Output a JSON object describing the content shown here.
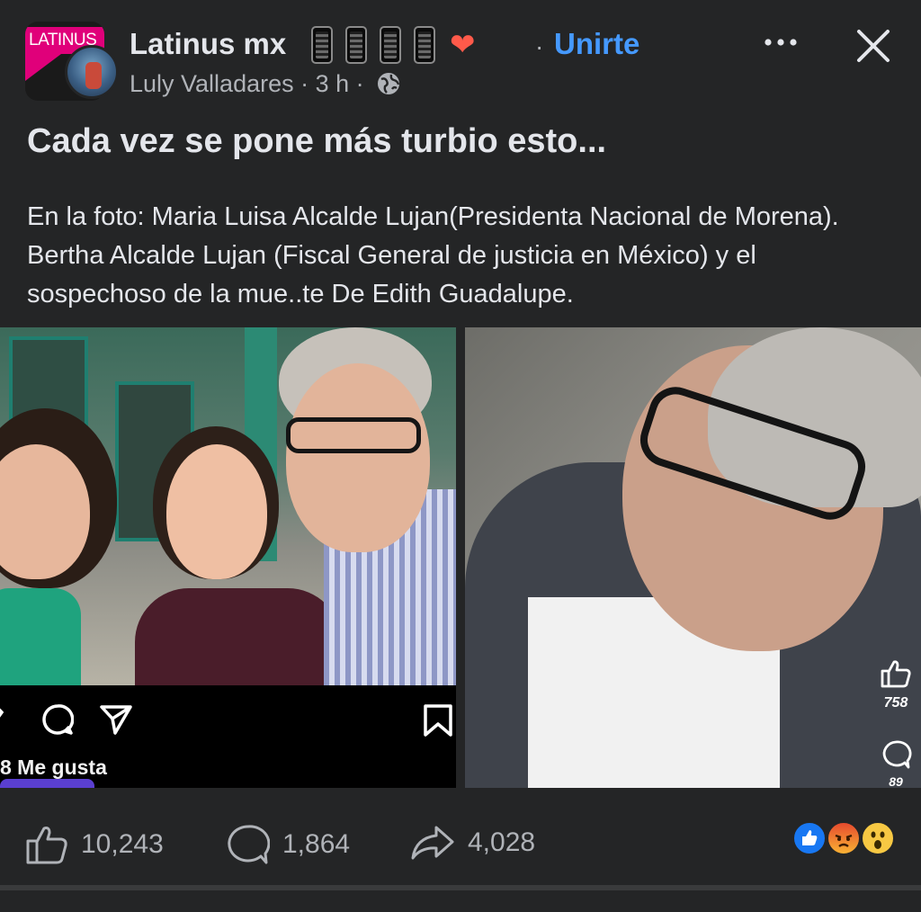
{
  "header": {
    "group_name": "Latinus mx",
    "group_logo_text": "LATINUS",
    "separator": "·",
    "join_label": "Unirte",
    "author_line": "Luly Valladares · 3 h ·",
    "emoji_icons": [
      "mobile-phone-icon",
      "mobile-phone-icon",
      "mobile-phone-icon",
      "mobile-phone-icon",
      "heart-on-fire-icon"
    ]
  },
  "post": {
    "title": "Cada vez se pone más turbio esto...",
    "body": "En la foto: Maria Luisa Alcalde Lujan(Presidenta Nacional de Morena). Bertha Alcalde Lujan (Fiscal General de justicia en México) y el sospechoso de la mue..te De Edith Guadalupe."
  },
  "left_image": {
    "instagram_likes_text": "8 Me gusta"
  },
  "right_image": {
    "like_count": "758",
    "comment_count": "89"
  },
  "footer": {
    "like_count": "10,243",
    "comment_count": "1,864",
    "share_count": "4,028",
    "reactions": [
      "like",
      "angry",
      "wow"
    ]
  },
  "colors": {
    "background": "#242526",
    "text": "#e4e6eb",
    "secondary_text": "#b0b3b8",
    "link": "#4599ff",
    "brand_pink": "#e0007a"
  }
}
